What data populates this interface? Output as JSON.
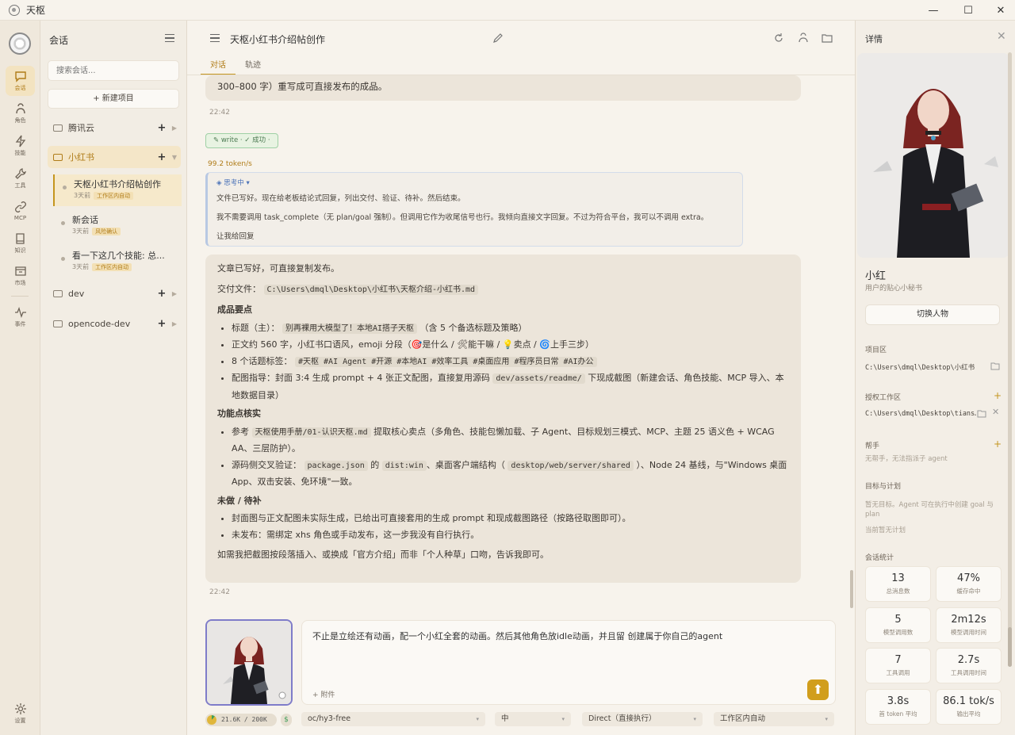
{
  "app": {
    "title": "天枢"
  },
  "rail": {
    "items": [
      {
        "label": "会话",
        "icon": "chat-icon",
        "active": true
      },
      {
        "label": "角色",
        "icon": "persona-icon"
      },
      {
        "label": "技能",
        "icon": "lightning-icon"
      },
      {
        "label": "工具",
        "icon": "wrench-icon"
      },
      {
        "label": "MCP",
        "icon": "link-icon"
      },
      {
        "label": "知识",
        "icon": "book-icon"
      },
      {
        "label": "市场",
        "icon": "store-icon"
      },
      {
        "label": "事件",
        "icon": "pulse-icon"
      }
    ],
    "settings_label": "设置"
  },
  "sidebar": {
    "title": "会话",
    "search_placeholder": "搜索会话...",
    "new_project": "+ 新建项目",
    "projects": [
      {
        "name": "腾讯云"
      },
      {
        "name": "小红书",
        "active": true
      },
      {
        "name": "dev"
      },
      {
        "name": "opencode-dev"
      }
    ],
    "sessions": [
      {
        "title": "天枢小红书介绍帖创作",
        "time": "3天前",
        "tag": "工作区内自动",
        "active": true
      },
      {
        "title": "新会话",
        "time": "3天前",
        "tag": "风险确认"
      },
      {
        "title": "看一下这几个技能: 总...",
        "time": "3天前",
        "tag": "工作区内自动"
      }
    ]
  },
  "main": {
    "title": "天枢小红书介绍帖创作",
    "tabs": [
      "对话",
      "轨迹"
    ],
    "prev_bubble_text": "300–800 字）重写成可直接发布的成品。",
    "prev_time": "22:42",
    "tool_chip": "✎ write · ✓ 成功 ·",
    "token_rate": "99.2 token/s",
    "thinking": {
      "header": "◈ 思考中 ▾",
      "line1": "文件已写好。现在给老板结论式回复，列出交付、验证、待补。然后结束。",
      "line2": "我不需要调用 task_complete（无 plan/goal 强制）。但调用它作为收尾信号也行。我倾向直接文字回复。不过为符合平台，我可以不调用 extra。",
      "line3": "让我给回复"
    },
    "answer": {
      "intro": "文章已写好，可直接复制发布。",
      "deliver_label": "交付文件：",
      "deliver_path": "C:\\Users\\dmql\\Desktop\\小红书\\天枢介绍-小红书.md",
      "h1": "成品要点",
      "b1_pre": "标题（主）：",
      "b1_code": "别再裸用大模型了！本地AI搭子天枢",
      "b1_post": "（含 5 个备选标题及策略）",
      "b2": "正文约 560 字，小红书口语风，emoji 分段（🎯是什么 / 🛠能干嘛 / 💡卖点 / 🌀上手三步）",
      "b3_pre": "8 个话题标签：",
      "b3_code": "#天枢 #AI Agent #开源 #本地AI #效率工具 #桌面应用 #程序员日常 #AI办公",
      "b4_pre": "配图指导：封面 3:4 生成 prompt + 4 张正文配图，直接复用源码",
      "b4_code": "dev/assets/readme/",
      "b4_post": "下现成截图（新建会话、角色技能、MCP 导入、本地数据目录）",
      "h2": "功能点核实",
      "c1_pre": "参考",
      "c1_code": "天枢使用手册/01-认识天枢.md",
      "c1_post": "提取核心卖点（多角色、技能包懒加载、子 Agent、目标规划三模式、MCP、主题 25 语义色 + WCAG AA、三层防护）。",
      "c2_pre": "源码侧交叉验证：",
      "c2_code1": "package.json",
      "c2_mid1": "的",
      "c2_code2": "dist:win",
      "c2_mid2": "、桌面客户端结构（",
      "c2_code3": "desktop/web/server/shared",
      "c2_post": "）、Node 24 基线，与\"Windows 桌面 App、双击安装、免环境\"一致。",
      "h3": "未做 / 待补",
      "d1": "封面图与正文配图未实际生成，已给出可直接套用的生成 prompt 和现成截图路径（按路径取图即可）。",
      "d2": "未发布：需绑定 xhs 角色或手动发布，这一步我没有自行执行。",
      "outro": "如需我把截图按段落插入、或换成「官方介绍」而非「个人种草」口吻，告诉我即可。"
    },
    "answer_time": "22:42",
    "input_text": "不止是立绘还有动画，配一个小红全套的动画。然后其他角色放idle动画，并且留 创建属于你自己的agent",
    "attach_label": "+ 附件",
    "context_usage": "21.6K / 200K",
    "context_fraction": 0.108,
    "model": "oc/hy3-free",
    "effort": "中",
    "mode": "Direct（直接执行）",
    "permission": "工作区内自动"
  },
  "right": {
    "title": "详情",
    "name": "小红",
    "subtitle": "用户的贴心小秘书",
    "switch_label": "切换人物",
    "project_dir_label": "项目区",
    "project_dir": "C:\\Users\\dmql\\Desktop\\小红书",
    "auth_ws_label": "授权工作区",
    "auth_ws": "C:\\Users\\dmql\\Desktop\\tians…",
    "helpers_label": "帮手",
    "helpers_hint": "无帮手，无法指派子 agent",
    "goals_label": "目标与计划",
    "goals_hint1": "暂无目标。Agent 可在执行中创建 goal 与 plan",
    "goals_hint2": "当前暂无计划",
    "stats_label": "会话统计",
    "stats": [
      {
        "value": "13",
        "key": "总消息数"
      },
      {
        "value": "47%",
        "key": "缓存命中"
      },
      {
        "value": "5",
        "key": "模型调用数"
      },
      {
        "value": "2m12s",
        "key": "模型调用时间"
      },
      {
        "value": "7",
        "key": "工具调用"
      },
      {
        "value": "2.7s",
        "key": "工具调用时间"
      },
      {
        "value": "3.8s",
        "key": "首 token 平均"
      },
      {
        "value": "86.1 tok/s",
        "key": "输出平均"
      }
    ]
  }
}
